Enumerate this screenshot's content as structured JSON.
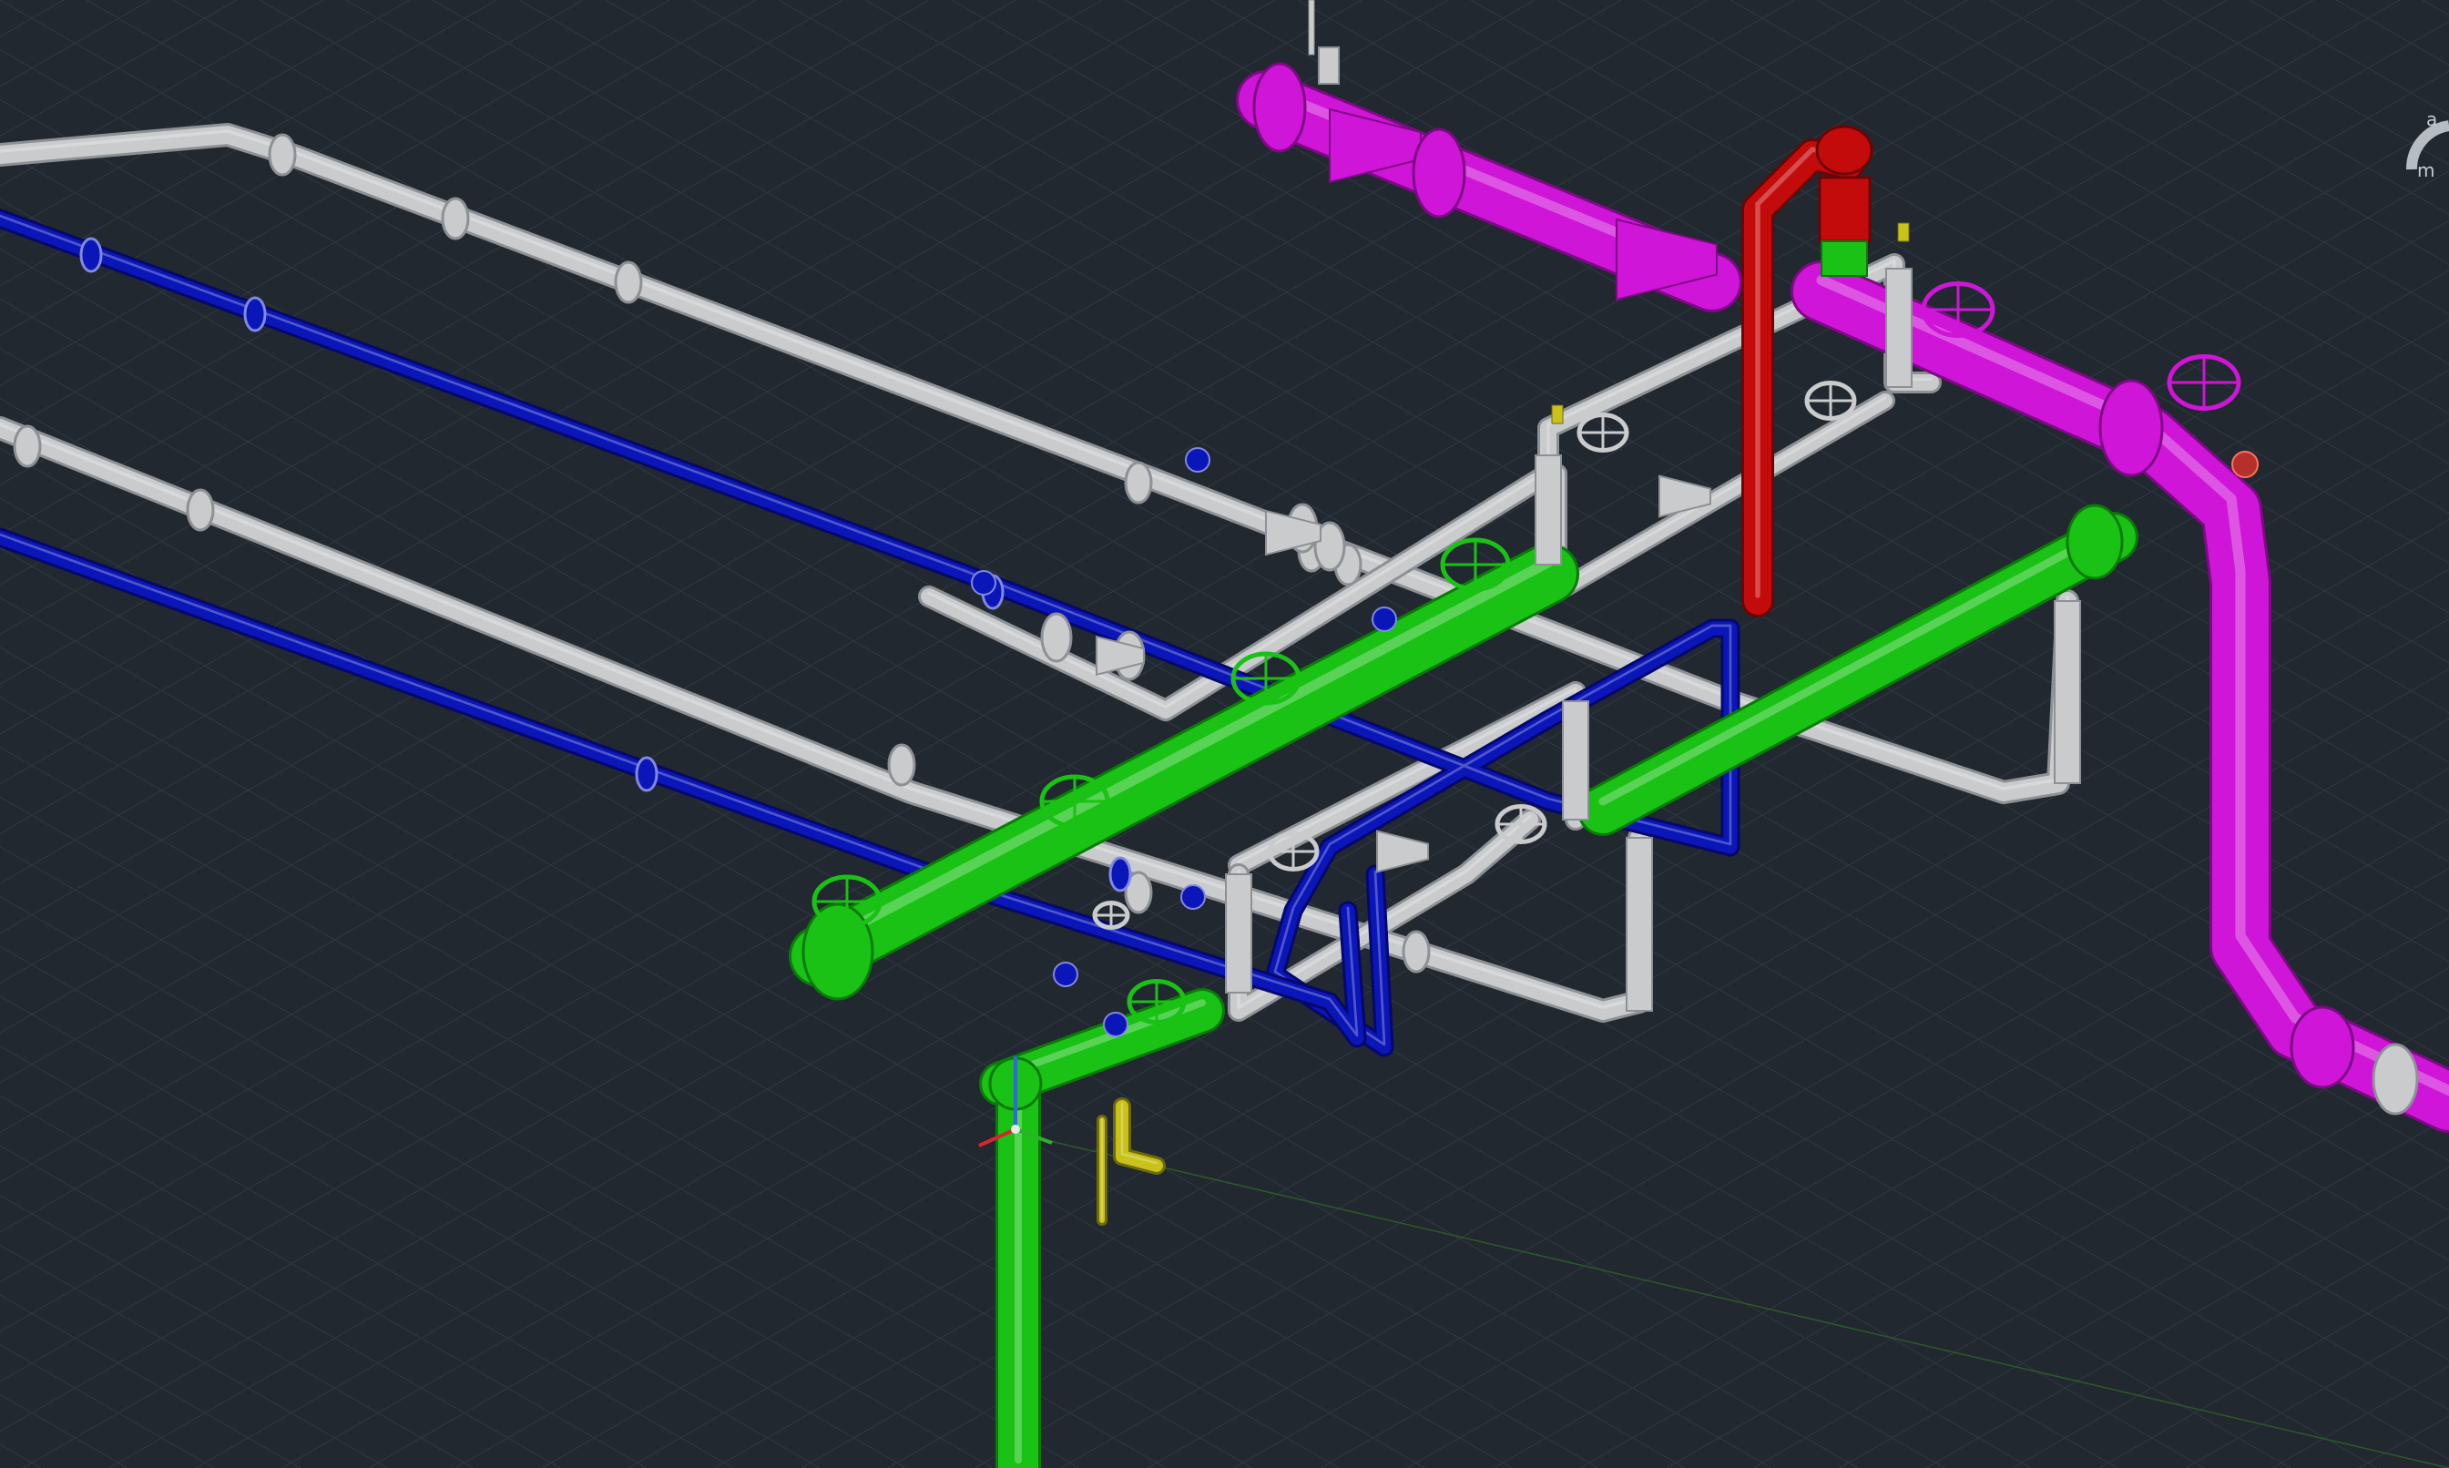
{
  "app": {
    "view": "SE Isometric",
    "visual_style": "Realistic"
  },
  "viewcube": {
    "compass_letter": "m",
    "compass_letter_2": "a"
  },
  "colors": {
    "background": "#212830",
    "grid_line": "#2e3640",
    "grid_line_major": "#353e49",
    "pipe_white": "#c9cbcd",
    "pipe_white_edge": "#8d9094",
    "pipe_blue": "#0b16b8",
    "pipe_blue_edge": "#05086a",
    "pipe_green": "#19c214",
    "pipe_green_edge": "#0b7a08",
    "pipe_magenta": "#cf15d8",
    "pipe_magenta_edge": "#7d0a84",
    "pipe_red": "#c40b0b",
    "pipe_red_edge": "#6b0505",
    "pipe_yellow": "#c9c21a",
    "ucs_x": "#d8262a",
    "ucs_y": "#2ab42a",
    "ucs_z": "#2f6bd8"
  },
  "icons": {
    "ucs": "ucs-axis-icon",
    "viewcube": "viewcube-compass-icon"
  }
}
